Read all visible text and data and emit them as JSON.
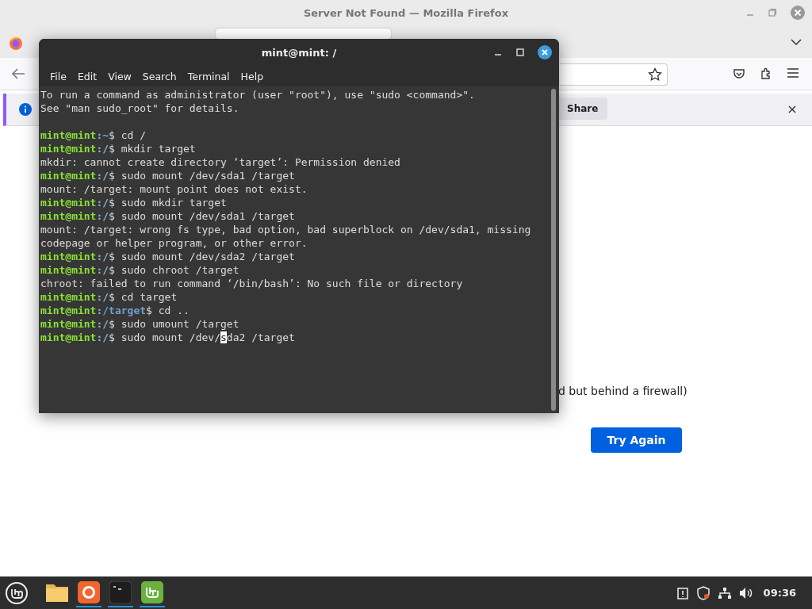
{
  "browser": {
    "title": "Server Not Found — Mozilla Firefox",
    "notification": {
      "button": "Share"
    },
    "content": {
      "text": "d but behind a firewall)",
      "button": "Try Again"
    }
  },
  "terminal": {
    "title": "mint@mint: /",
    "menu": [
      "File",
      "Edit",
      "View",
      "Search",
      "Terminal",
      "Help"
    ],
    "lines": [
      {
        "kind": "output",
        "text": "To run a command as administrator (user \"root\"), use \"sudo <command>\"."
      },
      {
        "kind": "output",
        "text": "See \"man sudo_root\" for details."
      },
      {
        "kind": "blank"
      },
      {
        "kind": "prompt",
        "user": "mint@mint",
        "sep": ":",
        "path": "~",
        "highlighted": false,
        "dollar": "$",
        "command": "cd /"
      },
      {
        "kind": "prompt",
        "user": "mint@mint",
        "sep": ":",
        "path": "/",
        "highlighted": false,
        "dollar": "$",
        "command": "mkdir target"
      },
      {
        "kind": "output",
        "text": "mkdir: cannot create directory ‘target’: Permission denied"
      },
      {
        "kind": "prompt",
        "user": "mint@mint",
        "sep": ":",
        "path": "/",
        "highlighted": false,
        "dollar": "$",
        "command": "sudo mount /dev/sda1 /target"
      },
      {
        "kind": "output",
        "text": "mount: /target: mount point does not exist."
      },
      {
        "kind": "prompt",
        "user": "mint@mint",
        "sep": ":",
        "path": "/",
        "highlighted": false,
        "dollar": "$",
        "command": "sudo mkdir target"
      },
      {
        "kind": "prompt",
        "user": "mint@mint",
        "sep": ":",
        "path": "/",
        "highlighted": false,
        "dollar": "$",
        "command": "sudo mount /dev/sda1 /target"
      },
      {
        "kind": "output",
        "text": "mount: /target: wrong fs type, bad option, bad superblock on /dev/sda1, missing"
      },
      {
        "kind": "output",
        "text": "codepage or helper program, or other error."
      },
      {
        "kind": "prompt",
        "user": "mint@mint",
        "sep": ":",
        "path": "/",
        "highlighted": false,
        "dollar": "$",
        "command": "sudo mount /dev/sda2 /target"
      },
      {
        "kind": "prompt",
        "user": "mint@mint",
        "sep": ":",
        "path": "/",
        "highlighted": false,
        "dollar": "$",
        "command": "sudo chroot /target"
      },
      {
        "kind": "output",
        "text": "chroot: failed to run command ‘/bin/bash’: No such file or directory"
      },
      {
        "kind": "prompt",
        "user": "mint@mint",
        "sep": ":",
        "path": "/",
        "highlighted": false,
        "dollar": "$",
        "command": "cd target"
      },
      {
        "kind": "prompt",
        "user": "mint@mint",
        "sep": ":",
        "path": "/target",
        "highlighted": true,
        "dollar": "$",
        "command": "cd .."
      },
      {
        "kind": "prompt",
        "user": "mint@mint",
        "sep": ":",
        "path": "/",
        "highlighted": false,
        "dollar": "$",
        "command": "sudo umount /target"
      },
      {
        "kind": "prompt",
        "user": "mint@mint",
        "sep": ":",
        "path": "/",
        "highlighted": false,
        "dollar": "$",
        "command": "sudo mount /dev/",
        "cursor_char": "s",
        "after": "da2 /target"
      }
    ]
  },
  "taskbar": {
    "apps": [
      {
        "kind": "files",
        "running": false
      },
      {
        "kind": "firefox",
        "running": true
      },
      {
        "kind": "terminal",
        "running": true
      },
      {
        "kind": "mint",
        "running": true
      }
    ],
    "clock": "09:36"
  }
}
